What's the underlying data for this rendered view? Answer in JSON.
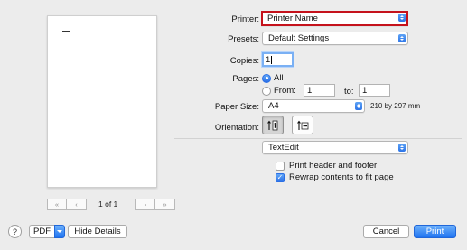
{
  "preview": {
    "page_counter": "1 of 1",
    "nav": [
      "«",
      "‹",
      "›",
      "»"
    ]
  },
  "printer": {
    "label": "Printer:",
    "value": "Printer Name"
  },
  "presets": {
    "label": "Presets:",
    "value": "Default Settings"
  },
  "copies": {
    "label": "Copies:",
    "value": "1"
  },
  "pages": {
    "label": "Pages:",
    "all_label": "All",
    "from_label": "From:",
    "from_value": "1",
    "to_label": "to:",
    "to_value": "1",
    "selected": "All"
  },
  "paper_size": {
    "label": "Paper Size:",
    "value": "A4",
    "dimensions": "210 by 297 mm"
  },
  "orientation": {
    "label": "Orientation:",
    "selected": "portrait"
  },
  "app_section": {
    "value": "TextEdit"
  },
  "options": [
    {
      "label": "Print header and footer",
      "checked": false
    },
    {
      "label": "Rewrap contents to fit page",
      "checked": true
    }
  ],
  "footer": {
    "help": "?",
    "pdf_label": "PDF",
    "hide_details_label": "Hide Details",
    "cancel_label": "Cancel",
    "print_label": "Print"
  },
  "colors": {
    "accent": "#2a6fe6",
    "highlight_border": "#c5121c"
  }
}
